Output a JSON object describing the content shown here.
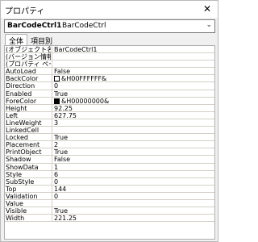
{
  "window": {
    "title": "プロパティ",
    "close_glyph": "✕"
  },
  "object_selector": {
    "name": "BarCodeCtrl1",
    "type": "BarCodeCtrl",
    "arrow_glyph": "⌄"
  },
  "tabs": [
    {
      "label": "全体",
      "active": true
    },
    {
      "label": "項目別",
      "active": false
    }
  ],
  "properties": [
    {
      "name": "(オブジェクト名)",
      "value": "BarCodeCtrl1"
    },
    {
      "name": "(バージョン情報)",
      "value": ""
    },
    {
      "name": "(プロパティ ページ)",
      "value": ""
    },
    {
      "name": "AutoLoad",
      "value": "False"
    },
    {
      "name": "BackColor",
      "value": "&H00FFFFFF&",
      "swatch": "#ffffff"
    },
    {
      "name": "Direction",
      "value": "0"
    },
    {
      "name": "Enabled",
      "value": "True"
    },
    {
      "name": "ForeColor",
      "value": "&H00000000&",
      "swatch": "#000000"
    },
    {
      "name": "Height",
      "value": "92.25"
    },
    {
      "name": "Left",
      "value": "627.75"
    },
    {
      "name": "LineWeight",
      "value": "3"
    },
    {
      "name": "LinkedCell",
      "value": ""
    },
    {
      "name": "Locked",
      "value": "True"
    },
    {
      "name": "Placement",
      "value": "2"
    },
    {
      "name": "PrintObject",
      "value": "True"
    },
    {
      "name": "Shadow",
      "value": "False"
    },
    {
      "name": "ShowData",
      "value": "1"
    },
    {
      "name": "Style",
      "value": "6"
    },
    {
      "name": "SubStyle",
      "value": "0"
    },
    {
      "name": "Top",
      "value": "144"
    },
    {
      "name": "Validation",
      "value": "0"
    },
    {
      "name": "Value",
      "value": ""
    },
    {
      "name": "Visible",
      "value": "True"
    },
    {
      "name": "Width",
      "value": "221.25"
    }
  ]
}
